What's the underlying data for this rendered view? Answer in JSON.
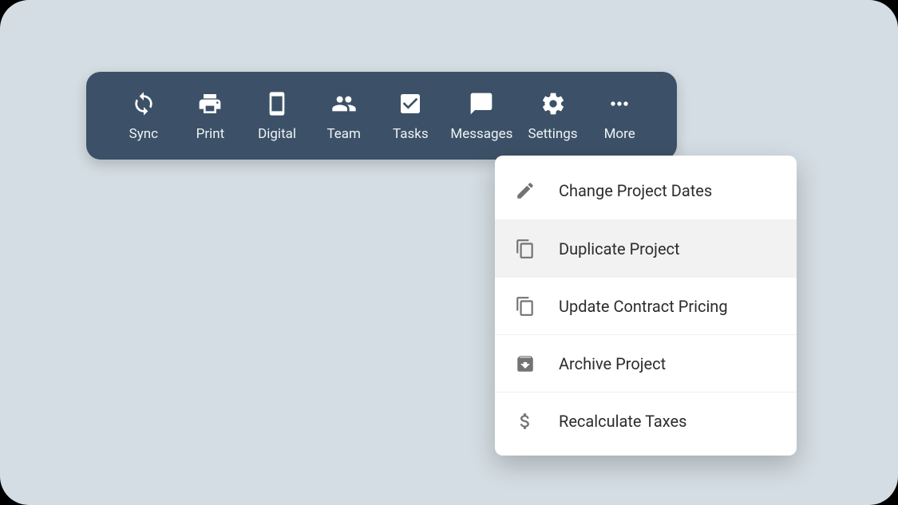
{
  "toolbar": {
    "items": [
      {
        "label": "Sync"
      },
      {
        "label": "Print"
      },
      {
        "label": "Digital"
      },
      {
        "label": "Team"
      },
      {
        "label": "Tasks"
      },
      {
        "label": "Messages"
      },
      {
        "label": "Settings"
      },
      {
        "label": "More"
      }
    ]
  },
  "more_menu": {
    "items": [
      {
        "label": "Change Project Dates"
      },
      {
        "label": "Duplicate Project"
      },
      {
        "label": "Update Contract Pricing"
      },
      {
        "label": "Archive Project"
      },
      {
        "label": "Recalculate Taxes"
      }
    ],
    "highlighted_index": 1
  },
  "colors": {
    "toolbar_bg": "#3c5167",
    "page_bg": "#d4dde3",
    "menu_icon": "#737373"
  }
}
